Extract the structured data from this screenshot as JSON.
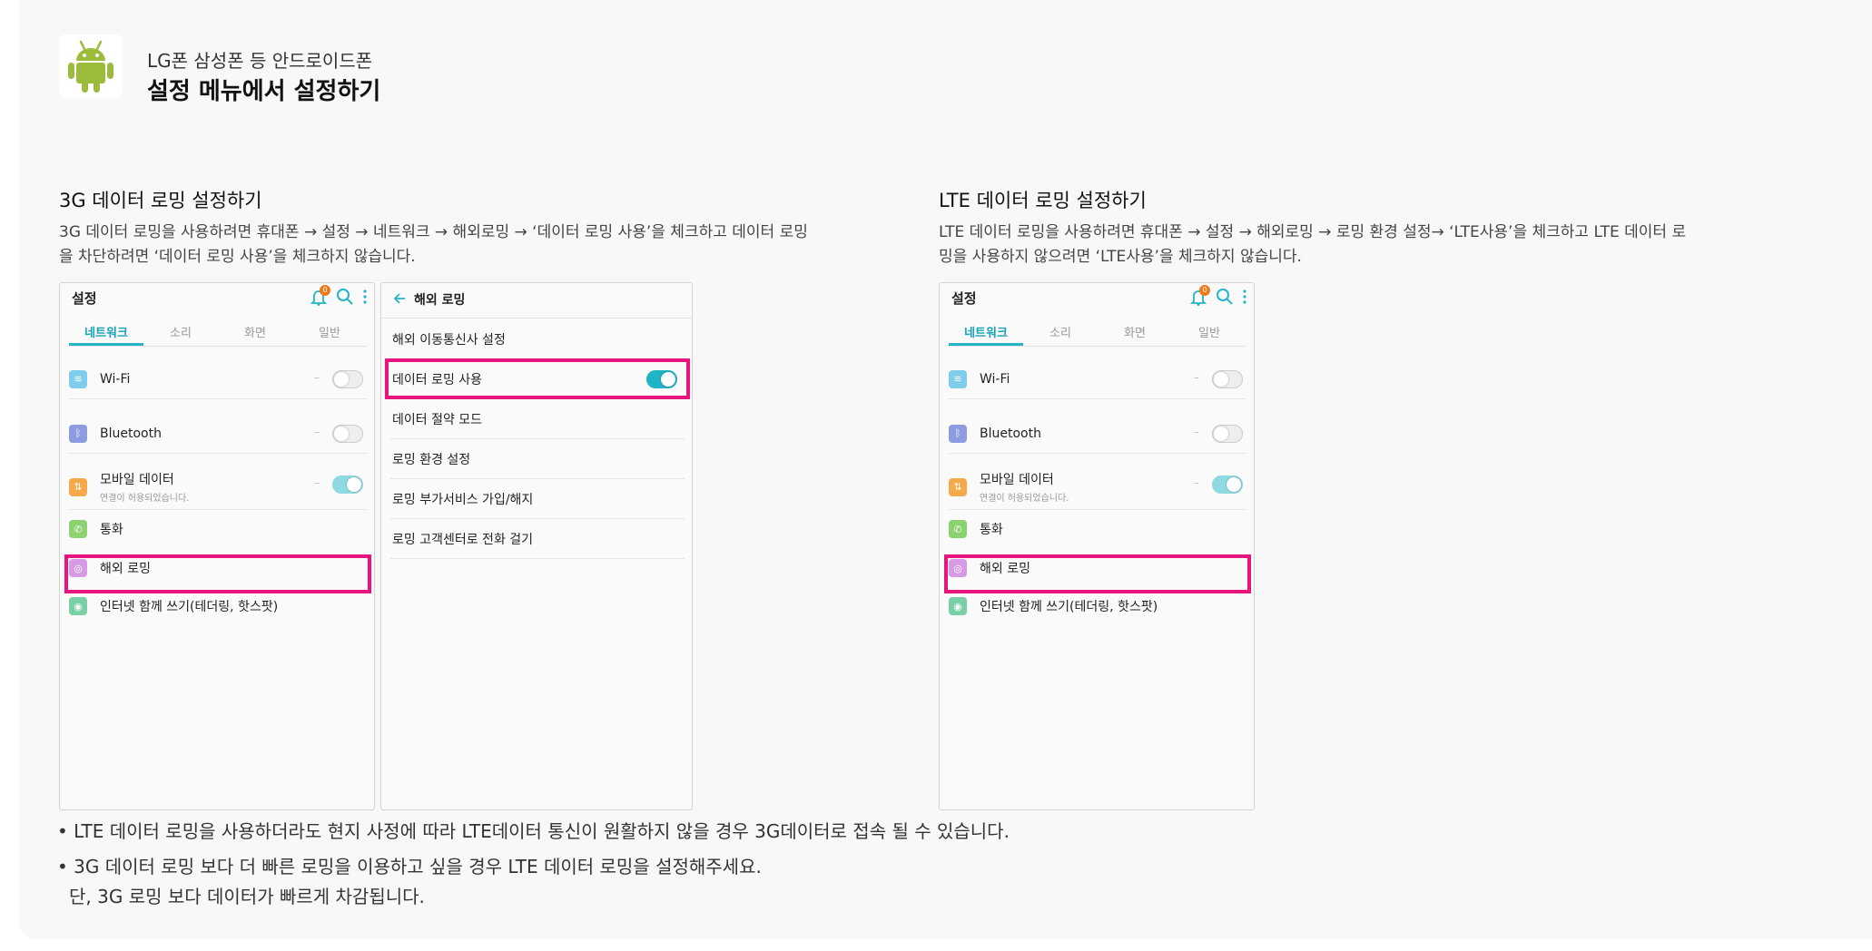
{
  "header": {
    "subtitle": "LG폰 삼성폰 등 안드로이드폰",
    "title": "설정 메뉴에서 설정하기",
    "icon": "android-icon"
  },
  "sections": {
    "g3": {
      "title": "3G 데이터 로밍 설정하기",
      "desc_line1": "3G 데이터 로밍을 사용하려면 휴대폰 → 설정 → 네트워크 → 해외로밍 → ‘데이터 로밍 사용’을 체크하고 데이터 로밍",
      "desc_line2": "을 차단하려면 ‘데이터 로밍 사용’을 체크하지 않습니다."
    },
    "lte": {
      "title": "LTE 데이터 로밍 설정하기",
      "desc_line1": "LTE 데이터 로밍을 사용하려면 휴대폰 → 설정 → 해외로밍 → 로밍 환경 설정→ ‘LTE사용’을 체크하고 LTE 데이터 로",
      "desc_line2": "밍을 사용하지 않으려면 ‘LTE사용’을 체크하지 않습니다."
    }
  },
  "settings_screen": {
    "title": "설정",
    "badge": "0",
    "tabs": [
      "네트워크",
      "소리",
      "화면",
      "일반"
    ],
    "rows": {
      "wifi": "Wi-Fi",
      "bluetooth": "Bluetooth",
      "mobile_data": "모바일 데이터",
      "mobile_data_sub": "연결이 허용되었습니다.",
      "call": "통화",
      "roaming": "해외 로밍",
      "tethering": "인터넷 함께 쓰기(테더링, 핫스팟)"
    },
    "toggle_dash": "–"
  },
  "roaming_screen": {
    "title": "해외 로밍",
    "items": [
      "해외 이동통신사 설정",
      "데이터 로밍 사용",
      "데이터 절약 모드",
      "로밍 환경 설정",
      "로밍 부가서비스 가입/해지",
      "로밍 고객센터로 전화 걸기"
    ]
  },
  "notes": {
    "note1": "• LTE 데이터 로밍을 사용하더라도 현지 사정에 따라 LTE데이터 통신이 원활하지 않을 경우 3G데이터로 접속 될 수 있습니다.",
    "note2": "• 3G 데이터 로밍 보다 더 빠른 로밍을 이용하고 싶을 경우 LTE 데이터 로밍을 설정해주세요.",
    "note2_cont": "단, 3G 로밍 보다 데이터가 빠르게 차감됩니다."
  },
  "colors": {
    "highlight": "#e8157e",
    "accent": "#26b5c8",
    "android_green": "#9bbb3b"
  }
}
